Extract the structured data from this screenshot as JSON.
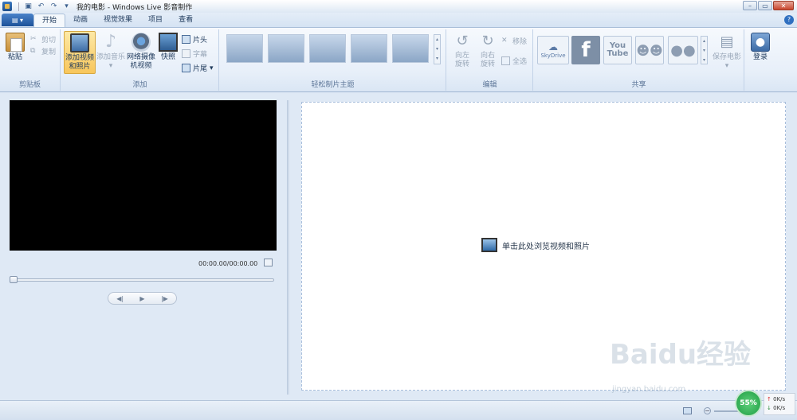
{
  "window": {
    "title": "我的电影 - Windows Live 影音制作"
  },
  "tabs": [
    {
      "label": "开始",
      "active": true
    },
    {
      "label": "动画",
      "active": false
    },
    {
      "label": "视觉效果",
      "active": false
    },
    {
      "label": "项目",
      "active": false
    },
    {
      "label": "查看",
      "active": false
    }
  ],
  "ribbon": {
    "clipboard": {
      "label": "剪贴板",
      "paste": "粘贴",
      "cut": "剪切",
      "copy": "复制"
    },
    "add": {
      "label": "添加",
      "add_video_photo_line1": "添加视频",
      "add_video_photo_line2": "和照片",
      "add_music": "添加音乐",
      "webcam_line1": "网络摄像",
      "webcam_line2": "机视频",
      "snapshot": "快照",
      "title": "片头",
      "caption": "字幕",
      "credits": "片尾"
    },
    "themes": {
      "label": "轻松制片主题"
    },
    "edit": {
      "label": "编辑",
      "rotate_left_line1": "向左",
      "rotate_left_line2": "旋转",
      "rotate_right_line1": "向右",
      "rotate_right_line2": "旋转",
      "remove": "移除",
      "select_all": "全选"
    },
    "share": {
      "label": "共享",
      "skydrive": "SkyDrive",
      "facebook": "f",
      "youtube_line1": "You",
      "youtube_line2": "Tube",
      "save_movie": "保存电影",
      "signin": "登录"
    }
  },
  "player": {
    "timecode": "00:00.00/00:00.00",
    "prev_frame": "◀|",
    "play": "▶",
    "next_frame": "|▶"
  },
  "storyboard": {
    "hint": "单击此处浏览视频和照片"
  },
  "overlay": {
    "watermark": "Baidu经验",
    "watermark_url": "jingyan.baidu.com",
    "net_percent": "55%",
    "upload_speed": "0K/s",
    "download_speed": "0K/s"
  },
  "colors": {
    "accent": "#1d5299",
    "ribbon_bg": "#e7eff9",
    "active_button": "#f8c65b",
    "facebook": "#3b5998",
    "youtube": "#7d8fa6"
  }
}
